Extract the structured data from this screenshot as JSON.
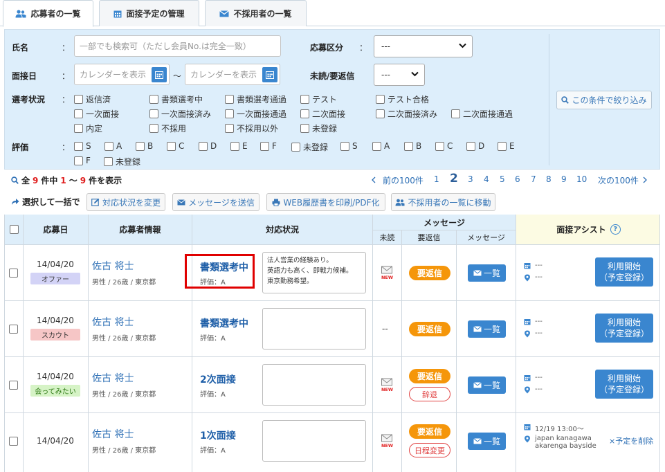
{
  "tabs": [
    {
      "label": "応募者の一覧",
      "icon": "users-icon",
      "active": true
    },
    {
      "label": "面接予定の管理",
      "icon": "calendar-icon",
      "active": false
    },
    {
      "label": "不採用者の一覧",
      "icon": "envelope-icon",
      "active": false
    }
  ],
  "search": {
    "name_label": "氏名",
    "name_placeholder": "一部でも検索可（ただし会員No.は完全一致）",
    "category_label": "応募区分",
    "category_value": "---",
    "interview_label": "面接日",
    "date_from_placeholder": "カレンダーを表示",
    "date_sep": "〜",
    "date_to_placeholder": "カレンダーを表示",
    "unread_label": "未読/要返信",
    "unread_value": "---",
    "selection_label": "選考状況",
    "selection_options": [
      "返信済",
      "書類選考中",
      "書類選考通過",
      "テスト",
      "テスト合格",
      "一次面接",
      "一次面接済み",
      "一次面接通過",
      "二次面接",
      "二次面接済み",
      "二次面接通過",
      "内定",
      "不採用",
      "不採用以外",
      "未登録"
    ],
    "rating_label": "評価",
    "rating_options": [
      "S",
      "A",
      "B",
      "C",
      "D",
      "E",
      "F",
      "未登録",
      "S",
      "A",
      "B",
      "C",
      "D",
      "E",
      "F",
      "未登録"
    ],
    "colon": "：",
    "filter_button": "この条件で絞り込み"
  },
  "results": {
    "prefix": "全",
    "total": "9",
    "mid": "件中",
    "from": "1",
    "tilde": "〜",
    "to": "9",
    "suffix": "件を表示"
  },
  "pagination": {
    "prev": "前の100件",
    "pages": [
      "1",
      "2",
      "3",
      "4",
      "5",
      "6",
      "7",
      "8",
      "9",
      "10"
    ],
    "current": "2",
    "next": "次の100件"
  },
  "bulk": {
    "label": "選択して一括で",
    "actions": [
      "対応状況を変更",
      "メッセージを送信",
      "WEB履歴書を印刷/PDF化",
      "不採用者の一覧に移動"
    ]
  },
  "table": {
    "headers": {
      "date": "応募日",
      "applicant": "応募者情報",
      "status": "対応状況",
      "message": "メッセージ",
      "unread": "未読",
      "reply": "要返信",
      "msg": "メッセージ",
      "assist": "面接アシスト",
      "help": "?"
    },
    "rows": [
      {
        "date": "14/04/20",
        "tag": "オファー",
        "tag_bg": "#d3d3f6",
        "tag_color": "#333",
        "name": "佐古 将士",
        "info": "男性 / 26歳 / 東京都",
        "status": "書類選考中",
        "eval": "評価：A",
        "memo": "法人営業の経験あり。\n英語力も高く、即戦力候補。\n東京勤務希望。",
        "unread": "new",
        "pills": [
          {
            "text": "要返信",
            "type": "orange"
          }
        ],
        "list_btn": "一覧",
        "assist_date": "---",
        "assist_place": "---",
        "action": "利用開始\n（予定登録）"
      },
      {
        "date": "14/04/20",
        "tag": "スカウト",
        "tag_bg": "#f6c6c6",
        "tag_color": "#333",
        "name": "佐古 将士",
        "info": "男性 / 26歳 / 東京都",
        "status": "書類選考中",
        "eval": "評価：A",
        "memo": "",
        "unread": "--",
        "pills": [
          {
            "text": "要返信",
            "type": "orange"
          }
        ],
        "list_btn": "一覧",
        "assist_date": "---",
        "assist_place": "---",
        "action": "利用開始\n（予定登録）"
      },
      {
        "date": "14/04/20",
        "tag": "会ってみたい",
        "tag_bg": "#d6f3c6",
        "tag_color": "#2e7a14",
        "name": "佐古 将士",
        "info": "男性 / 26歳 / 東京都",
        "status": "2次面接",
        "eval": "評価：A",
        "memo": "",
        "unread": "new",
        "pills": [
          {
            "text": "要返信",
            "type": "orange"
          },
          {
            "text": "辞退",
            "type": "outline"
          }
        ],
        "list_btn": "一覧",
        "assist_date": "---",
        "assist_place": "---",
        "action": "利用開始\n（予定登録）"
      },
      {
        "date": "14/04/20",
        "tag": "",
        "tag_bg": "",
        "tag_color": "",
        "name": "佐古 将士",
        "info": "男性 / 26歳 / 東京都",
        "status": "1次面接",
        "eval": "評価：A",
        "memo": "",
        "unread": "new",
        "pills": [
          {
            "text": "要返信",
            "type": "orange"
          },
          {
            "text": "日程変更",
            "type": "outline"
          }
        ],
        "list_btn": "一覧",
        "assist_date": "12/19 13:00〜",
        "assist_place": "japan kanagawa akarenga bayside",
        "action": "×予定を削除"
      }
    ]
  },
  "new_badge": "NEW",
  "colors": {
    "accent": "#3a86cf",
    "link": "#2d6fb5",
    "orange": "#f5960a",
    "red": "#e02020",
    "panel_bg": "#ddeefb"
  }
}
